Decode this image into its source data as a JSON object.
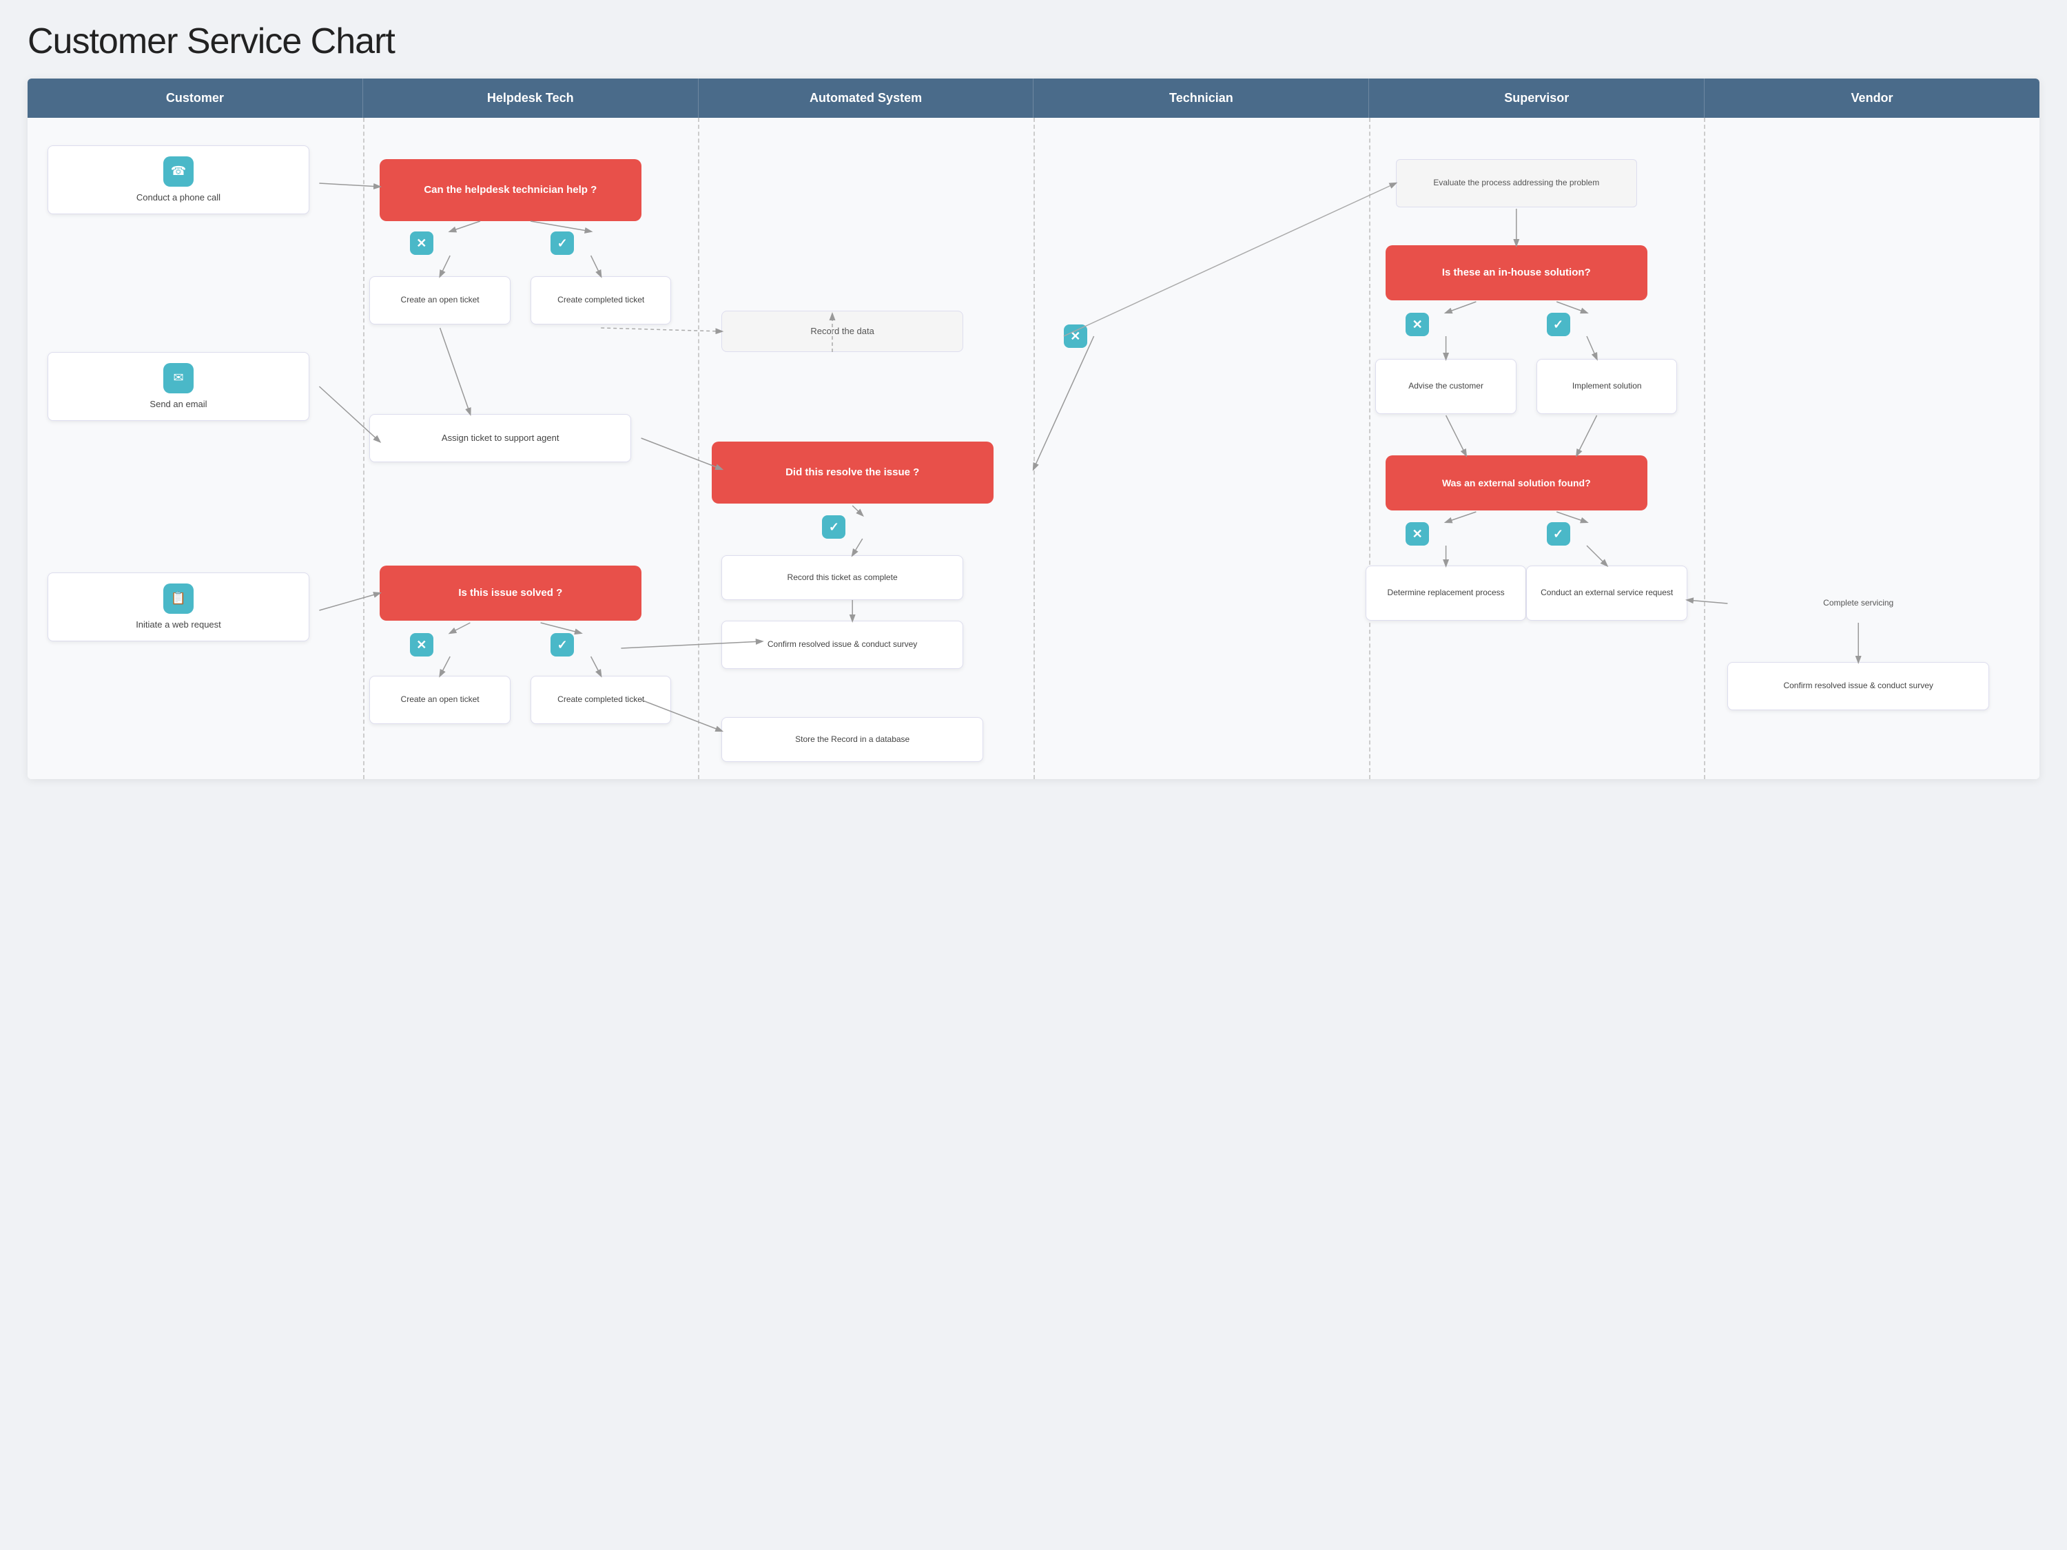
{
  "page": {
    "title": "Customer Service Chart"
  },
  "header": {
    "columns": [
      "Customer",
      "Helpdesk Tech",
      "Automated System",
      "Technician",
      "Supervisor",
      "Vendor"
    ]
  },
  "nodes": {
    "conduct_phone": {
      "label": "Conduct a phone call",
      "icon": "📞"
    },
    "send_email": {
      "label": "Send an email",
      "icon": "✉"
    },
    "initiate_web": {
      "label": "Initiate a web request",
      "icon": "📋"
    },
    "can_helpdesk": {
      "label": "Can the helpdesk technician help ?"
    },
    "create_open1": {
      "label": "Create an open ticket"
    },
    "create_completed1": {
      "label": "Create completed ticket"
    },
    "assign_ticket": {
      "label": "Assign ticket to support agent"
    },
    "is_issue_solved": {
      "label": "Is this issue solved ?"
    },
    "create_open2": {
      "label": "Create an open ticket"
    },
    "create_completed2": {
      "label": "Create completed ticket"
    },
    "record_data": {
      "label": "Record the data"
    },
    "did_resolve": {
      "label": "Did this resolve the issue ?"
    },
    "record_complete": {
      "label": "Record this ticket as complete"
    },
    "confirm_survey1": {
      "label": "Confirm resolved issue & conduct survey"
    },
    "store_record": {
      "label": "Store the Record in a database"
    },
    "evaluate_process": {
      "label": "Evaluate the process addressing the problem"
    },
    "in_house": {
      "label": "Is these an in-house solution?"
    },
    "advise_customer": {
      "label": "Advise the customer"
    },
    "implement_solution": {
      "label": "Implement solution"
    },
    "external_solution": {
      "label": "Was an external solution found?"
    },
    "determine_replacement": {
      "label": "Determine replacement process"
    },
    "conduct_external": {
      "label": "Conduct an external service request"
    },
    "complete_servicing": {
      "label": "Complete servicing"
    },
    "confirm_survey2": {
      "label": "Confirm resolved issue & conduct survey"
    }
  },
  "icons": {
    "phone": "☎",
    "email": "✉",
    "web": "📋",
    "x": "✕",
    "check": "✓"
  },
  "colors": {
    "header_bg": "#4a6b8a",
    "node_red": "#e8504a",
    "node_teal": "#4ab8c8",
    "node_white": "#ffffff",
    "lane_border": "#cccccc",
    "arrow": "#999999"
  }
}
